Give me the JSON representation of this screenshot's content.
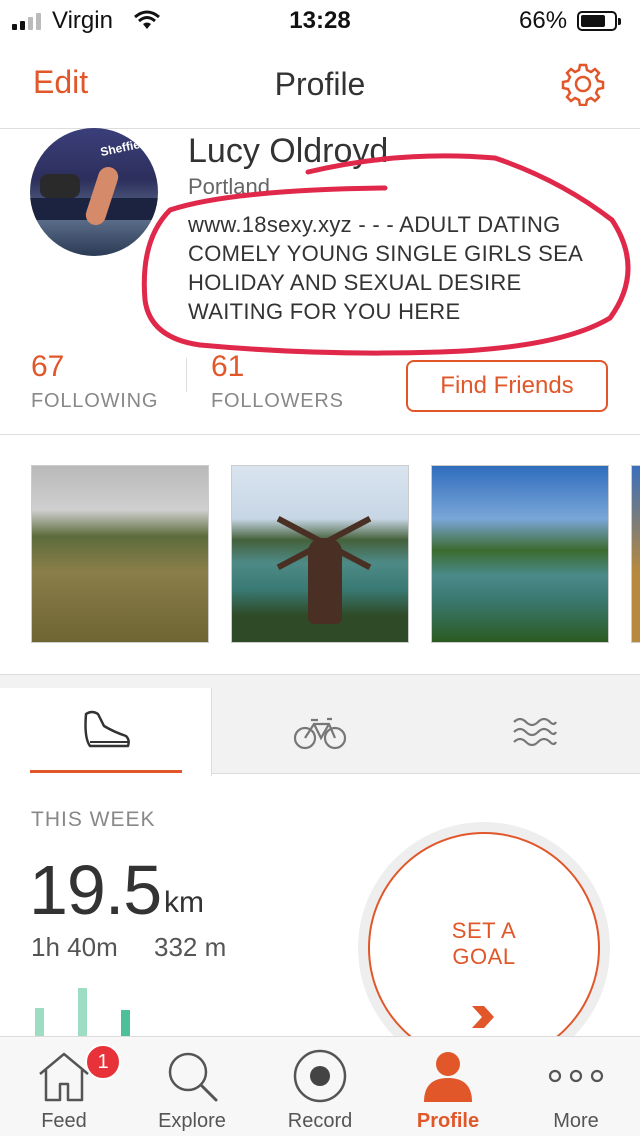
{
  "status_bar": {
    "carrier": "Virgin",
    "time": "13:28",
    "battery": "66%"
  },
  "nav": {
    "edit": "Edit",
    "title": "Profile",
    "settings_icon": "gear-icon"
  },
  "profile": {
    "name": "Lucy Oldroyd",
    "location": "Portland",
    "bio": "www.18sexy.xyz  - - - ADULT DATING COMELY YOUNG SINGLE GIRLS SEA HOLIDAY AND SEXUAL DESIRE WAITING FOR YOU HERE",
    "following_count": "67",
    "following_label": "FOLLOWING",
    "followers_count": "61",
    "followers_label": "FOLLOWERS",
    "find_friends": "Find Friends"
  },
  "sport_tabs": [
    {
      "icon": "running-shoe-icon",
      "active": true
    },
    {
      "icon": "bicycle-icon",
      "active": false
    },
    {
      "icon": "swim-waves-icon",
      "active": false
    }
  ],
  "week": {
    "label": "THIS WEEK",
    "distance": "19.5",
    "unit": "km",
    "time": "1h 40m",
    "elevation": "332 m"
  },
  "goal": {
    "line1": "SET A",
    "line2": "GOAL"
  },
  "bottom_tabs": [
    {
      "label": "Feed",
      "icon": "home-icon",
      "badge": "1"
    },
    {
      "label": "Explore",
      "icon": "search-icon"
    },
    {
      "label": "Record",
      "icon": "record-icon"
    },
    {
      "label": "Profile",
      "icon": "person-icon",
      "active": true
    },
    {
      "label": "More",
      "icon": "more-dots-icon"
    }
  ],
  "colors": {
    "accent": "#e1572a",
    "badge": "#e8323a",
    "annotation": "#e0284a"
  }
}
